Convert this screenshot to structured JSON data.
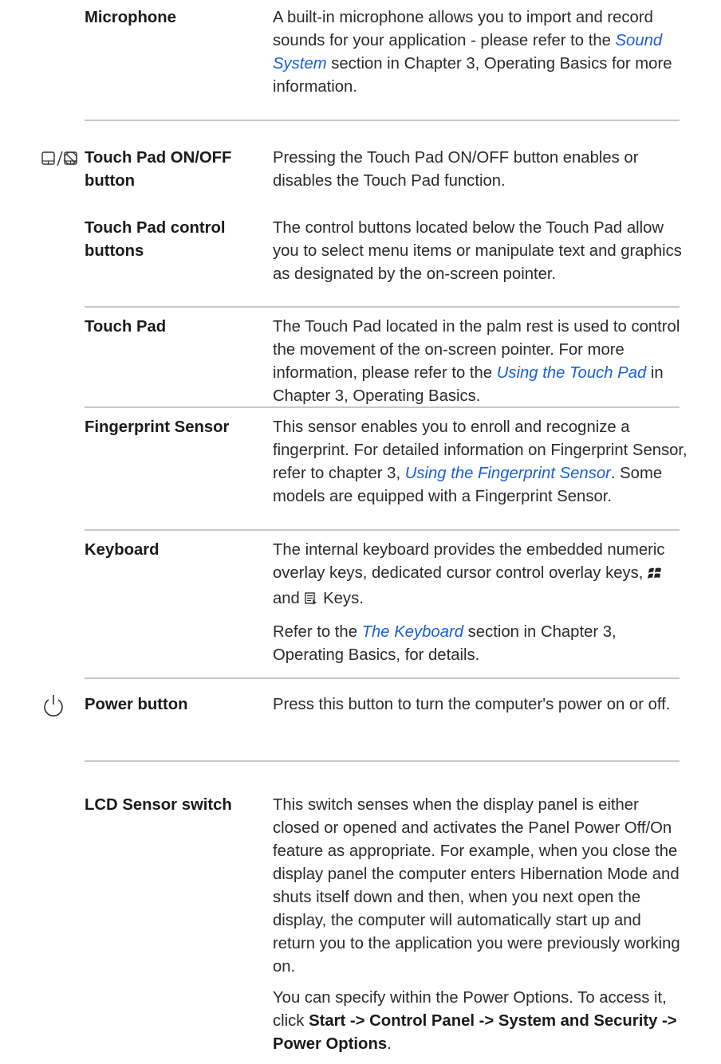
{
  "rows": {
    "microphone": {
      "term": "Microphone",
      "desc_a": "A built-in microphone allows you to import and record sounds for your application - please refer to the ",
      "link": "Sound System",
      "desc_b": " section in Chapter 3, Operating Basics for more information."
    },
    "touchpad_onoff": {
      "icon": "touch-pad-on-off-icon",
      "term": "Touch Pad ON/OFF button",
      "desc": "Pressing the Touch Pad ON/OFF button enables or disables the Touch Pad function."
    },
    "touchpad_control": {
      "term": "Touch Pad control buttons",
      "desc": "The control buttons located below the Touch Pad allow you to select menu items or manipulate text and graphics as designated by the on-screen pointer."
    },
    "touchpad": {
      "term": "Touch Pad",
      "desc_a": "The Touch Pad located in the palm rest is used to control the movement of the on-screen pointer. For more information, please refer to the ",
      "link": "Using the Touch Pad",
      "desc_b": " in Chapter 3, Operating Basics."
    },
    "fingerprint": {
      "term": "Fingerprint Sensor",
      "desc_a": "This sensor enables you to enroll and recognize a fingerprint. For detailed information on Fingerprint Sensor, refer to chapter 3, ",
      "link": "Using the Fingerprint Sensor",
      "desc_b": ". Some models are equipped with a Fingerprint Sensor."
    },
    "keyboard": {
      "term": "Keyboard",
      "desc_a": "The internal keyboard provides the embedded numeric overlay keys, dedicated cursor control overlay keys, ",
      "desc_and": " and ",
      "desc_keys": " Keys.",
      "p2_a": "Refer to the ",
      "link": "The Keyboard",
      "p2_b": " section in Chapter 3, Operating Basics, for details."
    },
    "power": {
      "icon": "power-icon",
      "term": "Power button",
      "desc": "Press this button to turn the computer's power on or off."
    },
    "lcd": {
      "term": "LCD Sensor switch",
      "desc": "This switch senses when the display panel is either closed or opened and activates the Panel Power Off/On feature as appropriate. For example, when you close the display panel the computer enters Hibernation Mode and shuts itself down and then, when you next open the display, the computer will automatically start up and return you to the application you were previously working on.",
      "p2_a": "You can specify within the Power Options. To access it, click ",
      "p2_bold": "Start -> Control Panel -> System and Security -> Power Options",
      "p2_b": "."
    }
  },
  "colors": {
    "link": "#1a5fd6",
    "rule": "#c8c8c8",
    "text": "#2b2b2b"
  }
}
